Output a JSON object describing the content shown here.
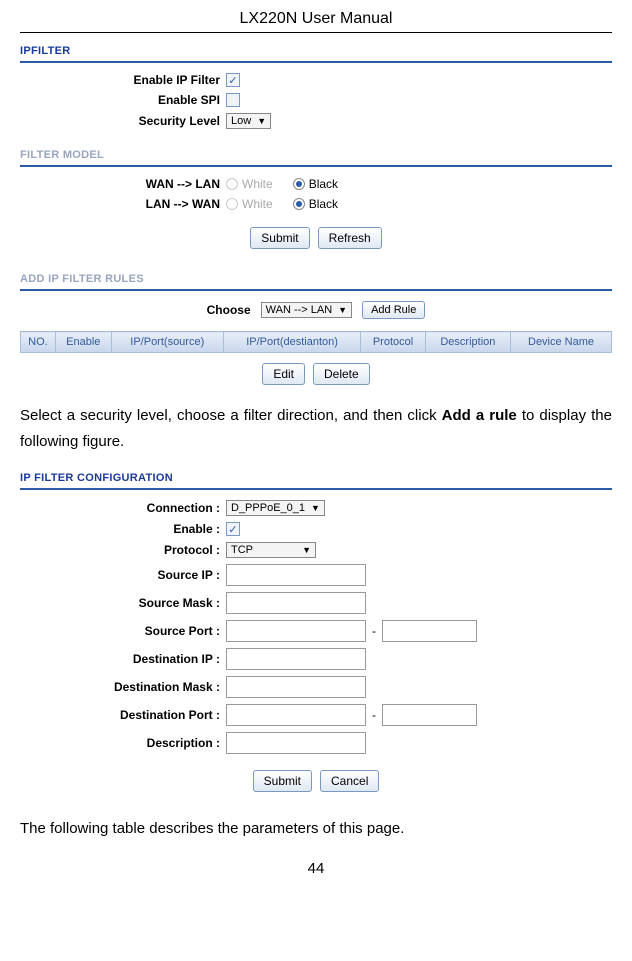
{
  "header": {
    "title": "LX220N User Manual"
  },
  "ipfilter": {
    "title": "IPFILTER",
    "enable_ip_filter_label": "Enable IP Filter",
    "enable_ip_filter_checked": "✓",
    "enable_spi_label": "Enable SPI",
    "security_level_label": "Security Level",
    "security_level_value": "Low"
  },
  "filter_model": {
    "title": "FILTER MODEL",
    "wan_lan_label": "WAN --> LAN",
    "lan_wan_label": "LAN --> WAN",
    "white_label": "White",
    "black_label": "Black",
    "submit_label": "Submit",
    "refresh_label": "Refresh"
  },
  "add_rules": {
    "title": "ADD IP FILTER RULES",
    "choose_label": "Choose",
    "choose_value": "WAN --> LAN",
    "add_rule_label": "Add Rule",
    "headers": [
      "NO.",
      "Enable",
      "IP/Port(source)",
      "IP/Port(destianton)",
      "Protocol",
      "Description",
      "Device Name"
    ],
    "edit_label": "Edit",
    "delete_label": "Delete"
  },
  "paragraph1": {
    "prefix": "Select a security level, choose a filter direction, and then click ",
    "bold": "Add a rule",
    "suffix": " to display the following figure."
  },
  "ip_filter_config": {
    "title": "IP FILTER CONFIGURATION",
    "connection_label": "Connection :",
    "connection_value": "D_PPPoE_0_1",
    "enable_label": "Enable :",
    "enable_checked": "✓",
    "protocol_label": "Protocol :",
    "protocol_value": "TCP",
    "source_ip_label": "Source IP :",
    "source_mask_label": "Source Mask :",
    "source_port_label": "Source Port :",
    "dest_ip_label": "Destination IP :",
    "dest_mask_label": "Destination Mask :",
    "dest_port_label": "Destination Port :",
    "description_label": "Description :",
    "dash": "-",
    "submit_label": "Submit",
    "cancel_label": "Cancel"
  },
  "paragraph2": "The following table describes the parameters of this page.",
  "page_number": "44"
}
